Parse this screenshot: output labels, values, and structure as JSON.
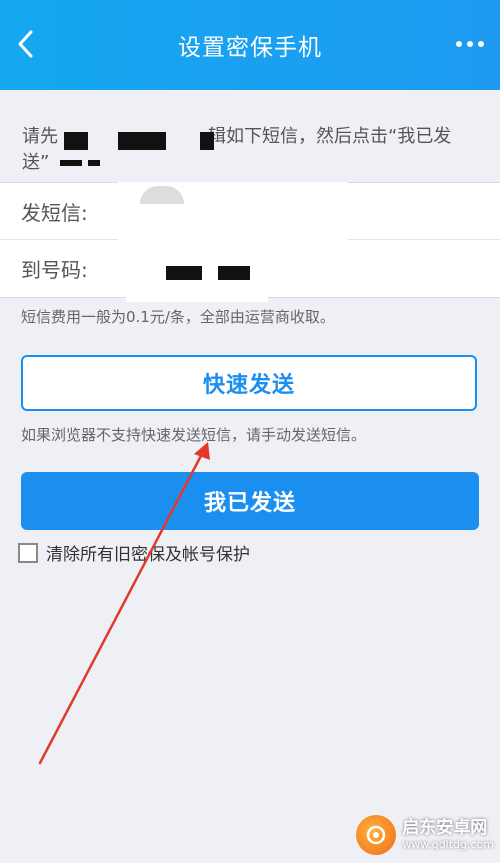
{
  "header": {
    "title": "设置密保手机",
    "back_icon": "chevron-left-icon",
    "more_icon": "more-dots-icon",
    "color": "#1a9ef0"
  },
  "instruction": {
    "prefix": "请先",
    "middle": "辑如下短信，然后点击“我已发",
    "suffix": "送”"
  },
  "form": {
    "sms_label": "发短信:",
    "number_label": "到号码:"
  },
  "fee_note": "短信费用一般为0.1元/条，全部由运营商收取。",
  "buttons": {
    "fast_send": "快速发送",
    "sent": "我已发送"
  },
  "hint": "如果浏览器不支持快速发送短信，请手动发送短信。",
  "checkbox": {
    "label": "清除所有旧密保及帐号保护",
    "checked": false
  },
  "annotation": {
    "color": "#e23a2a"
  },
  "watermark": {
    "name": "启东安卓网",
    "url": "www.qdltdg.com"
  },
  "colors": {
    "primary": "#1a8ff0",
    "background": "#eef0f6"
  }
}
